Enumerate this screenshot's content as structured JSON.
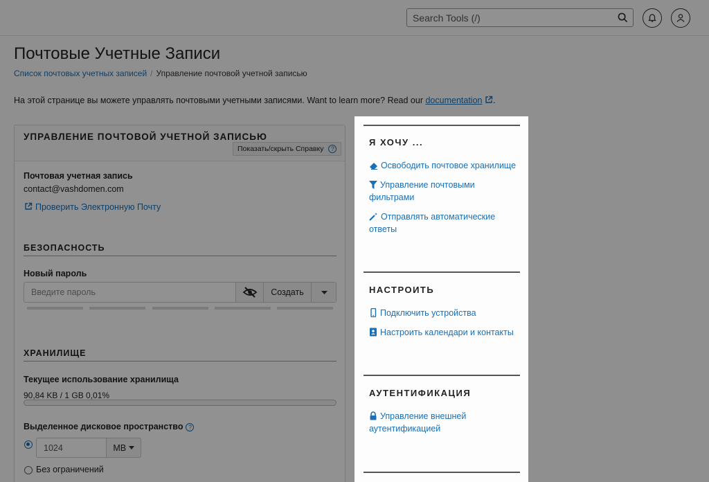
{
  "header": {
    "search_placeholder": "Search Tools (/)"
  },
  "page": {
    "title": "Почтовые Учетные Записи",
    "breadcrumb": {
      "link": "Список почтовых учетных записей",
      "current": "Управление почтовой учетной записью"
    },
    "intro": {
      "text": "На этой странице вы можете управлять почтовыми учетными записями. Want to learn more? Read our ",
      "link": "documentation",
      "end": "."
    }
  },
  "card": {
    "title": "УПРАВЛЕНИЕ ПОЧТОВОЙ УЧЕТНОЙ ЗАПИСЬЮ",
    "help_button": "Показать/скрыть Справку",
    "account_label": "Почтовая учетная запись",
    "account_value": "contact@vashdomen.com",
    "check_email_link": "Проверить Электронную Почту",
    "security": {
      "title": "БЕЗОПАСНОСТЬ",
      "new_password_label": "Новый пароль",
      "password_placeholder": "Введите пароль",
      "generate_button": "Создать"
    },
    "storage": {
      "title": "ХРАНИЛИЩЕ",
      "usage_label": "Текущее использование хранилища",
      "usage_value": "90,84 KB / 1 GB 0,01%",
      "usage_fraction": 0.0001,
      "quota_label": "Выделенное дисковое пространство",
      "quota_value": "1024",
      "quota_unit": "MB",
      "unlimited_label": "Без ограничений"
    }
  },
  "sidebar": {
    "sections": [
      {
        "title": "Я ХОЧУ ...",
        "links": [
          {
            "icon": "eraser-icon",
            "label": "Освободить почтовое хранилище"
          },
          {
            "icon": "filter-icon",
            "label": "Управление почтовыми фильтрами"
          },
          {
            "icon": "magic-wand-icon",
            "label": "Отправлять автоматические ответы"
          }
        ]
      },
      {
        "title": "НАСТРОИТЬ",
        "links": [
          {
            "icon": "mobile-icon",
            "label": "Подключить устройства"
          },
          {
            "icon": "address-book-icon",
            "label": "Настроить календари и контакты"
          }
        ]
      },
      {
        "title": "АУТЕНТИФИКАЦИЯ",
        "links": [
          {
            "icon": "lock-icon",
            "label": "Управление внешней аутентификацией"
          }
        ]
      }
    ]
  },
  "colors": {
    "link": "#1a6fb5",
    "overlay": "rgba(0,0,0,0.43)"
  }
}
